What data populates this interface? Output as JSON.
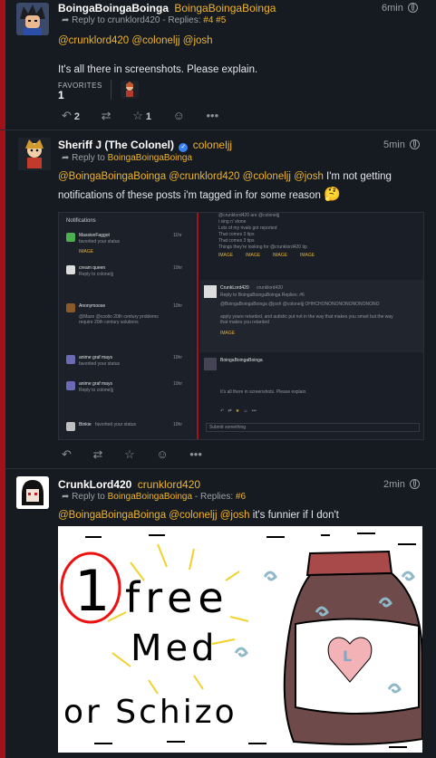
{
  "posts": [
    {
      "name": "BoingaBoingaBoinga",
      "handle": "BoingaBoingaBoinga",
      "time": "6min",
      "reply_prefix": "Reply to",
      "reply_to": "crunklord420",
      "replies_label": "Replies:",
      "replies": "#4 #5",
      "mentions": "@crunklord420 @coloneljj @josh",
      "text": "It's all there in screenshots. Please explain.",
      "favorites_label": "FAVORITES",
      "favorites_count": "1",
      "repeat_count": "2",
      "fav_count": "1"
    },
    {
      "name": "Sheriff J (The Colonel)",
      "handle": "coloneljj",
      "time": "5min",
      "reply_prefix": "Reply to",
      "reply_to": "BoingaBoingaBoinga",
      "mentions": "@BoingaBoingaBoinga @crunklord420 @coloneljj @josh",
      "text_rest": " I'm not getting",
      "text_line2": "notifications of these posts i'm tagged in for some reason",
      "emoji": "🤔",
      "screenshot": {
        "notifications_title": "Notifications",
        "rows": [
          {
            "user": "MassiveFaggot",
            "action": "favorited your status",
            "time": "11hr"
          },
          {
            "user": "cream queen",
            "action": "Reply to coloneljj",
            "time": "10hr"
          },
          {
            "user": "Anonymoose",
            "action": "@Maze @coolio 20th century problems require 20th century solutions",
            "time": "10hr"
          },
          {
            "user": "anime graf mays",
            "action": "favorited your status",
            "time": "10hr"
          },
          {
            "user": "anime graf mays",
            "action": "Reply to coloneljj",
            "time": "10hr"
          },
          {
            "user": "Binkie",
            "action": "favorited your status",
            "time": "10hr"
          }
        ],
        "right_lines": [
          "@crunklord420 are @coloneljj",
          "i sing n' stone",
          "Lots of my rivals got reported",
          "That comes 3 tips",
          "That comes 3 tips",
          "Things they're looking for @crunklord420 tip"
        ],
        "right_post_user": "CrunkLord420",
        "right_post_handle": "crunklord420",
        "right_post_reply": "Reply to BoingaBoingaBoinga Replies: #6",
        "right_post_text": "@BoingaBoingaBoinga @josh @coloneljj OHHCHONONONONONONONONO",
        "right_post_text2": "apply youre retarded, and autistic put not in the way that makes you smart but the way that makes you retarded",
        "image_tag": "IMAGE",
        "bottom_user": "BoingaBoingaBoinga",
        "bottom_text": "It's all there in screenshots. Please explain.",
        "reply_placeholder": "Submit something"
      }
    },
    {
      "name": "CrunkLord420",
      "handle": "crunklord420",
      "time": "2min",
      "reply_prefix": "Reply to",
      "reply_to": "BoingaBoingaBoinga",
      "replies_label": "Replies:",
      "replies": "#6",
      "mentions": "@BoingaBoingaBoinga @coloneljj @josh",
      "text": " it's funnier if I don't",
      "drawing": {
        "line1": "free",
        "line2": "Med",
        "line3": "or Schizo",
        "number": "1",
        "heart_letter": "L"
      }
    }
  ],
  "colors": {
    "accent": "#f0b429",
    "rail": "#a3121a",
    "background": "#0f1117",
    "card": "#161a21"
  }
}
